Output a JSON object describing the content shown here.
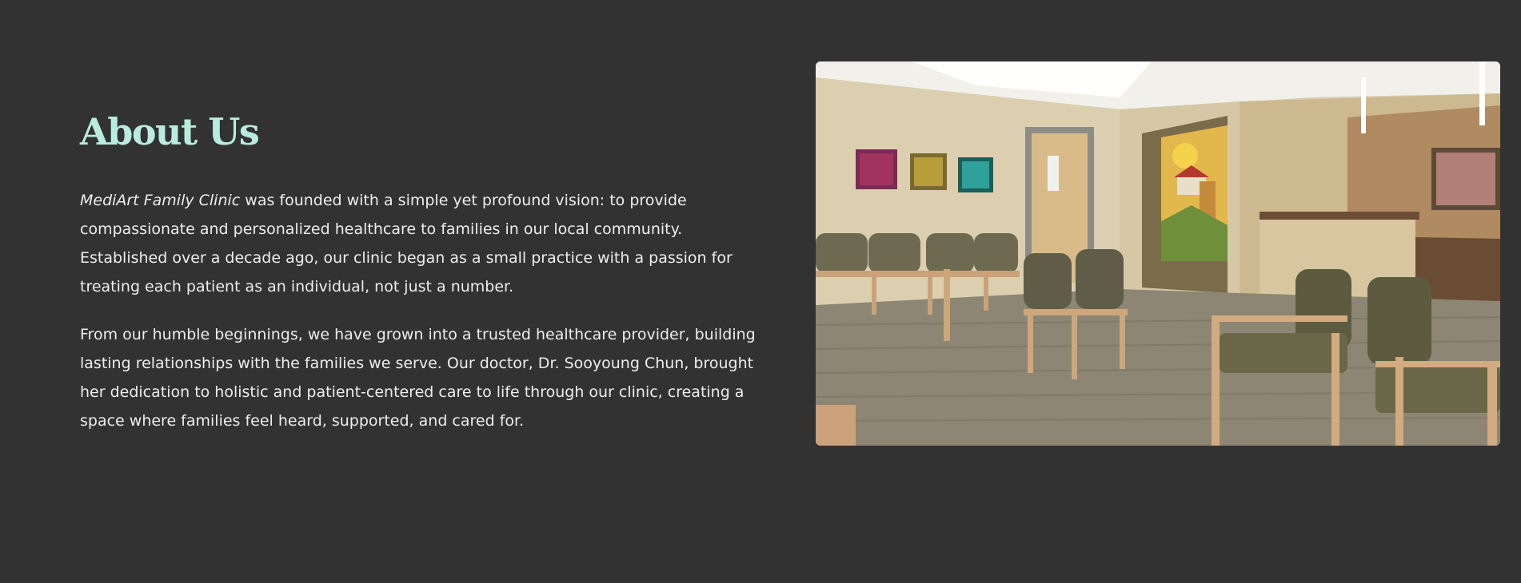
{
  "about": {
    "heading": "About Us",
    "paragraph1_clinic_name": "MediArt Family Clinic",
    "paragraph1_rest": " was founded with a simple yet profound vision: to provide compassionate and personalized healthcare to families in our local community. Established over a decade ago, our clinic began as a small practice with a passion for treating each patient as an individual, not just a number.",
    "paragraph2": "From our humble beginnings, we have grown into a trusted healthcare provider, building lasting relationships with the families we serve. Our doctor, Dr. Sooyoung Chun, brought her dedication to holistic and patient-centered care to life through our clinic, creating a space where families feel heard, supported, and cared for."
  },
  "colors": {
    "background": "#323232",
    "heading": "#b9ecdc",
    "body_text": "#ededed"
  }
}
